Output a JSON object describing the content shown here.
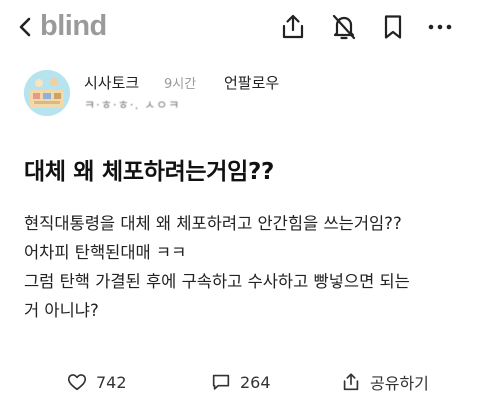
{
  "app": {
    "brand": "blind"
  },
  "toolbar": {
    "icons": [
      "back-icon",
      "share-icon",
      "notification-off-icon",
      "bookmark-icon",
      "more-icon"
    ]
  },
  "post": {
    "channel": "시사토크",
    "time_ago": "9시간",
    "follow_label": "언팔로우",
    "author_meta": "ㅋ·ㅎ·ㅎ·. ㅅㅇㅋ",
    "title": "대체 왜 체포하려는거임??",
    "body_lines": [
      "현직대통령을 대체 왜 체포하려고 안간힘을 쓰는거임??",
      "어차피 탄핵된대매 ㅋㅋ",
      "그럼 탄핵 가결된 후에 구속하고 수사하고 빵넣으면 되는",
      "거 아니냐?"
    ]
  },
  "actions": {
    "likes": "742",
    "comments": "264",
    "share_label": "공유하기"
  }
}
